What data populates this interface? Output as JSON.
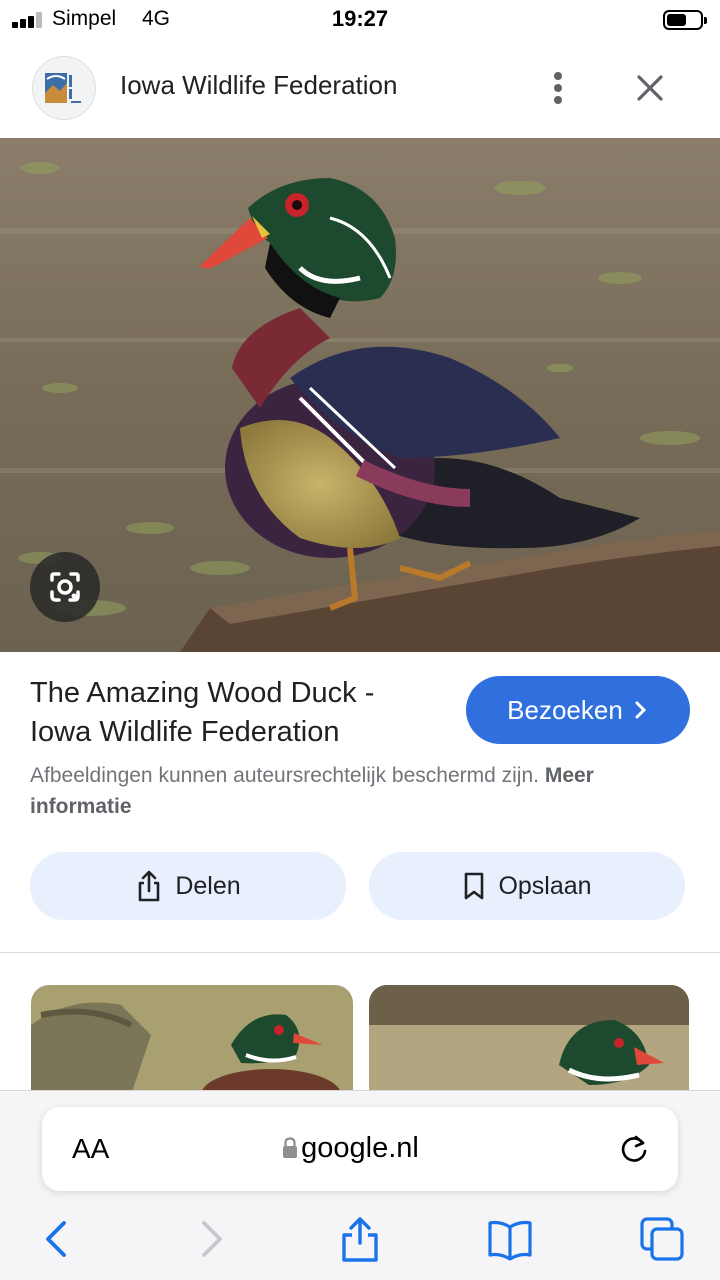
{
  "status_bar": {
    "carrier": "Simpel",
    "network": "4G",
    "time": "19:27",
    "battery_level": 0.6
  },
  "header": {
    "title": "Iowa Wildlife Federation",
    "logo_icon": "iowa-wildlife-federation-logo",
    "menu_icon": "more-vert-icon",
    "close_icon": "close-icon"
  },
  "hero": {
    "subject": "wood-duck-photo",
    "lens_icon": "google-lens-icon"
  },
  "result": {
    "title": "The Amazing Wood Duck - Iowa Wildlife Federation",
    "visit_label": "Bezoeken",
    "copyright_text": "Afbeeldingen kunnen auteursrechtelijk beschermd zijn.",
    "more_info_label": "Meer informatie",
    "share_label": "Delen",
    "save_label": "Opslaan"
  },
  "browser": {
    "aa_label": "AA",
    "domain": "google.nl",
    "accent_color": "#2f6fde"
  }
}
